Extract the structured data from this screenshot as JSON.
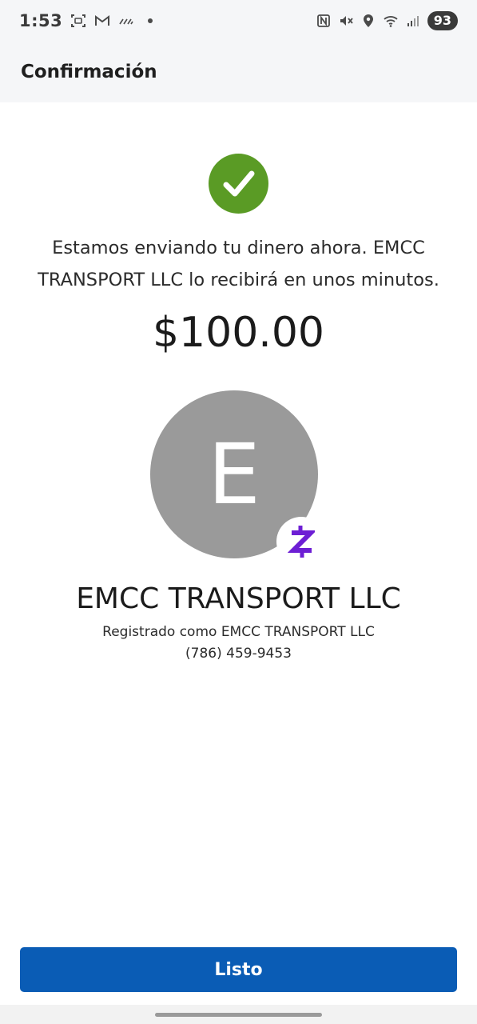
{
  "status_bar": {
    "time": "1:53",
    "battery": "93",
    "left_icons": [
      "screenshot-icon",
      "gmail-icon",
      "signal-wave-icon",
      "dot-icon"
    ],
    "right_icons": [
      "nfc-icon",
      "mute-icon",
      "location-icon",
      "wifi-icon",
      "cell-signal-icon"
    ]
  },
  "header": {
    "title": "Confirmación"
  },
  "confirmation": {
    "message": "Estamos enviando tu dinero ahora. EMCC TRANSPORT LLC lo recibirá en unos minutos.",
    "amount": "$100.00",
    "success_color": "#5a9b25"
  },
  "recipient": {
    "avatar_letter": "E",
    "name": "EMCC TRANSPORT LLC",
    "registered_as": "Registrado como EMCC TRANSPORT LLC",
    "phone": "(786) 459-9453",
    "badge_icon": "zelle-icon",
    "badge_color": "#6d1ed4"
  },
  "actions": {
    "done_label": "Listo",
    "primary_color": "#0a5cb5"
  }
}
